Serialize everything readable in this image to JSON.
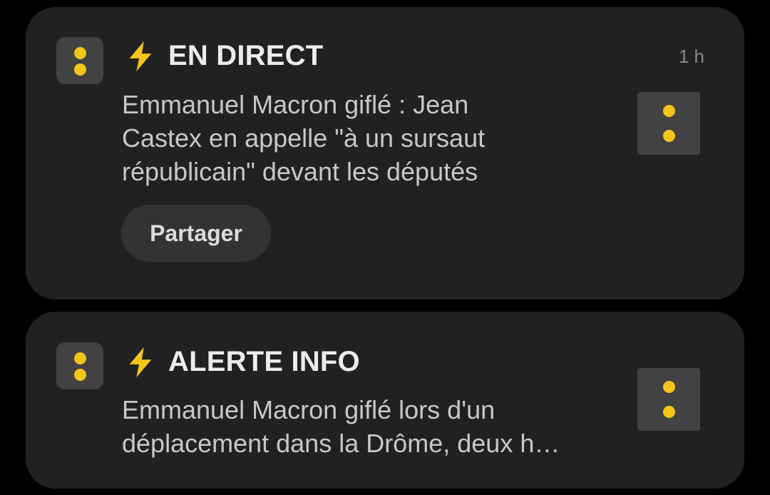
{
  "colors": {
    "background": "#000000",
    "card": "#212121",
    "icon_bg": "#424242",
    "accent_yellow": "#f5c518",
    "title_text": "#ececec",
    "body_text": "#c8c8c8"
  },
  "notifications": [
    {
      "app_icon": "app-logo-icon",
      "title_icon": "lightning-bolt-icon",
      "title": "EN DIRECT",
      "time": "1 h",
      "body": "Emmanuel Macron giflé : Jean Castex en appelle \"à un sursaut républicain\" devant les députés",
      "action": "Partager",
      "thumbnail_icon": "app-logo-icon"
    },
    {
      "app_icon": "app-logo-icon",
      "title_icon": "lightning-bolt-icon",
      "title": "ALERTE INFO",
      "body": "Emmanuel Macron giflé lors d'un déplacement dans la Drôme, deux h…",
      "thumbnail_icon": "app-logo-icon"
    }
  ]
}
